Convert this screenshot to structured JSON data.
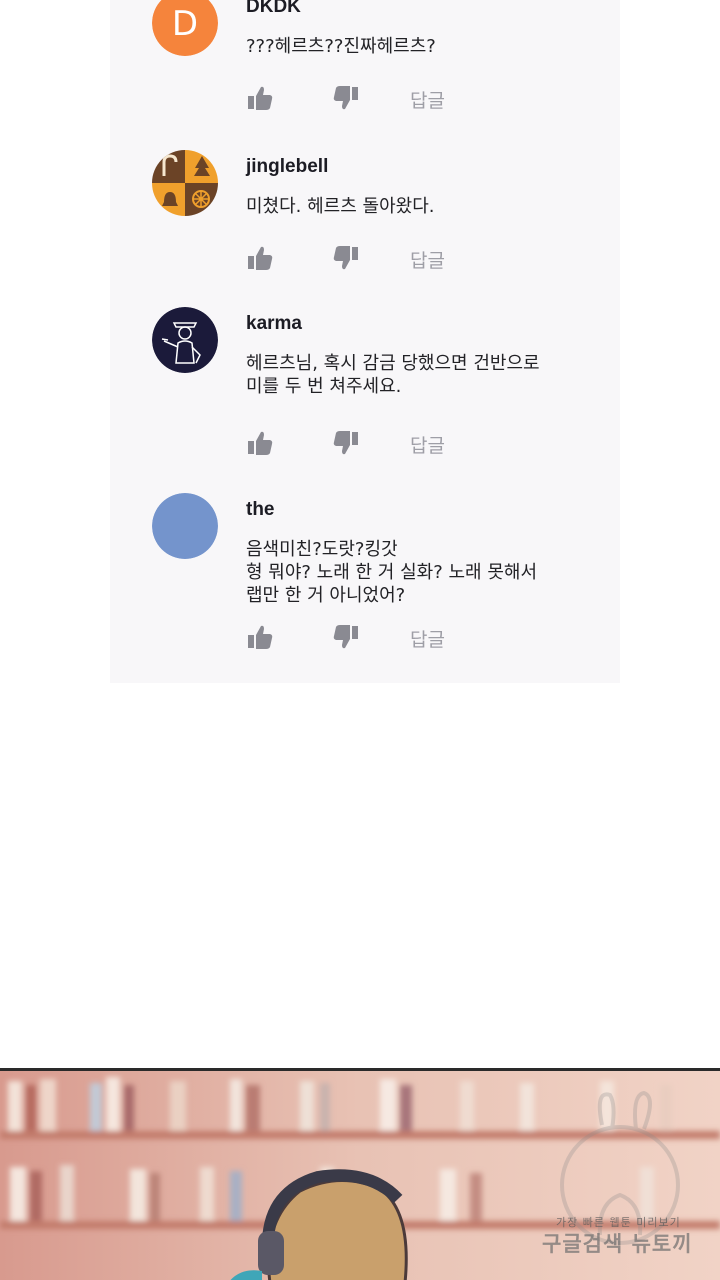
{
  "comments": [
    {
      "username": "DKDK",
      "avatar_letter": "D",
      "avatar_color": "#f5843c",
      "text": "???헤르츠??진짜헤르츠?",
      "reply_label": "답글"
    },
    {
      "username": "jinglebell",
      "avatar_icon": "christmas-quadrant-icon",
      "text": "미쳤다. 헤르츠 돌아왔다.",
      "reply_label": "답글"
    },
    {
      "username": "karma",
      "avatar_icon": "sketch-person-icon",
      "text": "헤르츠님, 혹시 감금 당했으면 건반으로\n미를 두 번 쳐주세요.",
      "reply_label": "답글"
    },
    {
      "username": "the",
      "avatar_color": "#7494cc",
      "text": "음색미친?도랏?킹갓\n형 뭐야? 노래 한 거 실화? 노래 못해서\n랩만 한 거 아니었어?",
      "reply_label": "답글"
    }
  ],
  "watermark": {
    "line1": "가장 빠른 웹툰 미리보기",
    "line2": "구글검색 뉴토끼"
  },
  "colors": {
    "panel_bg": "#f8f7f9",
    "action_icon": "#8a8a92",
    "reply_text": "#9e9ea6"
  }
}
